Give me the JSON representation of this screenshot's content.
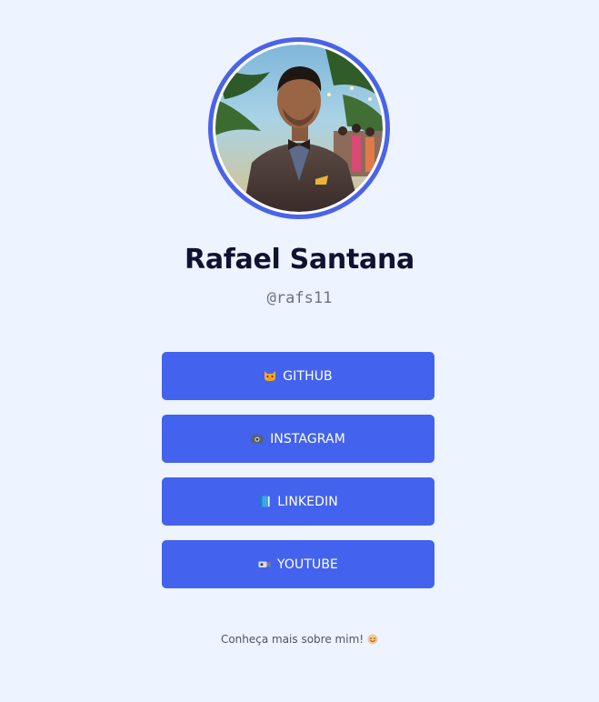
{
  "profile": {
    "name": "Rafael Santana",
    "handle": "@rafs11",
    "avatar_icon": "profile-photo"
  },
  "links": [
    {
      "label": "GITHUB",
      "icon": "cat-face-emoji"
    },
    {
      "label": "INSTAGRAM",
      "icon": "camera-emoji"
    },
    {
      "label": "LINKEDIN",
      "icon": "blue-book-emoji"
    },
    {
      "label": "YOUTUBE",
      "icon": "video-camera-emoji"
    }
  ],
  "footer": {
    "text": "Conheça mais sobre mim!",
    "icon": "smiling-face-emoji"
  },
  "colors": {
    "background": "#EDF3FF",
    "button": "#4362EE",
    "ring": "#4B63E6",
    "name": "#0E1330",
    "handle": "#6B7280"
  }
}
